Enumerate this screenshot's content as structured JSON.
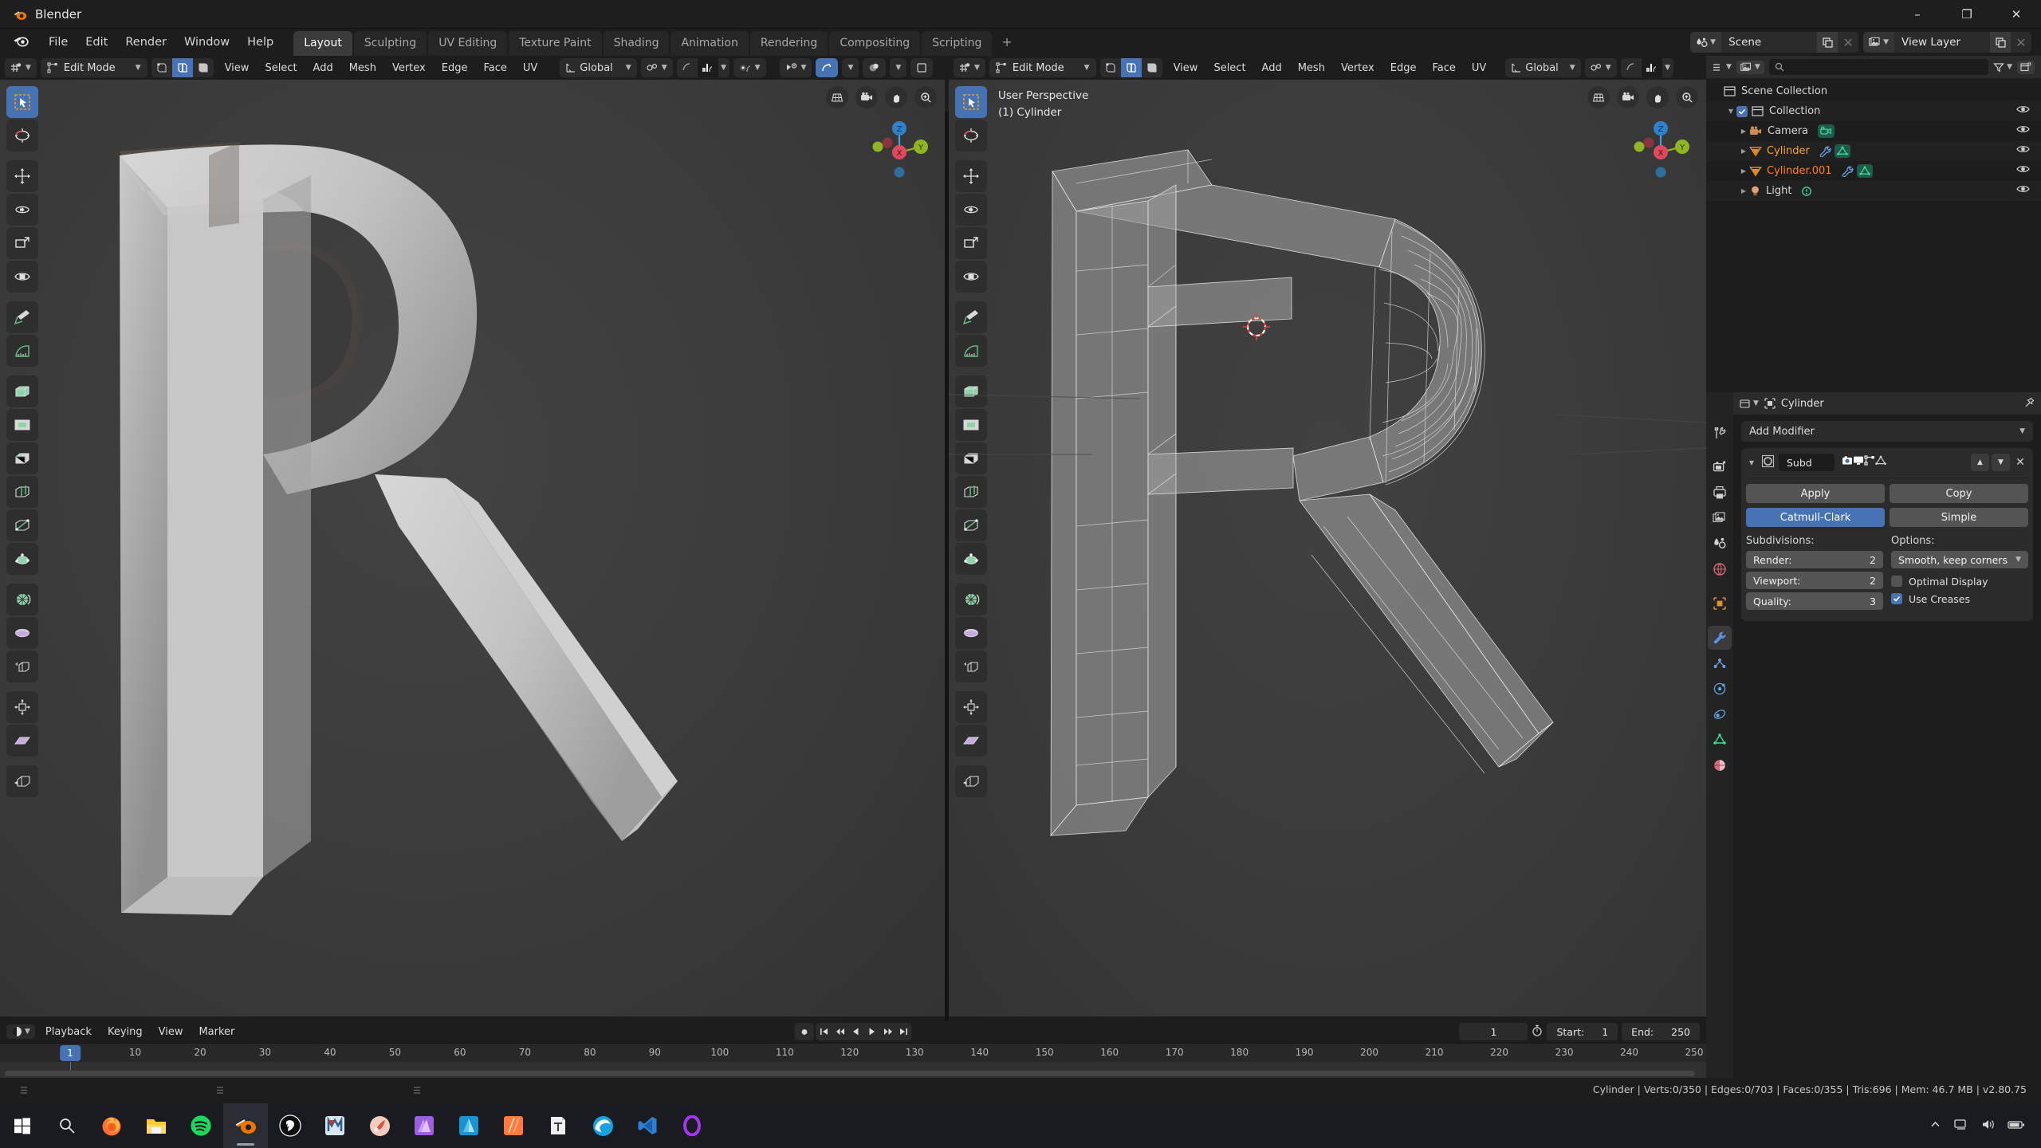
{
  "window": {
    "app_title": "Blender",
    "minimize_label": "–",
    "maximize_label": "❐",
    "close_label": "✕"
  },
  "topbar": {
    "menus": [
      "File",
      "Edit",
      "Render",
      "Window",
      "Help"
    ],
    "workspace_tabs": [
      {
        "label": "Layout",
        "active": true
      },
      {
        "label": "Sculpting",
        "active": false
      },
      {
        "label": "UV Editing",
        "active": false
      },
      {
        "label": "Texture Paint",
        "active": false
      },
      {
        "label": "Shading",
        "active": false
      },
      {
        "label": "Animation",
        "active": false
      },
      {
        "label": "Rendering",
        "active": false
      },
      {
        "label": "Compositing",
        "active": false
      },
      {
        "label": "Scripting",
        "active": false
      }
    ],
    "add_workspace_label": "+",
    "scene_name": "Scene",
    "view_layer_name": "View Layer"
  },
  "viewport_left": {
    "mode": "Edit Mode",
    "menus": [
      "View",
      "Select",
      "Add",
      "Mesh",
      "Vertex",
      "Edge",
      "Face",
      "UV"
    ],
    "transform_orientation": "Global",
    "select_mode": [
      "vertex-select",
      "edge-select",
      "face-select"
    ],
    "active_select_mode": "edge-select"
  },
  "viewport_right": {
    "mode": "Edit Mode",
    "menus": [
      "View",
      "Select",
      "Add",
      "Mesh",
      "Vertex",
      "Edge",
      "Face",
      "UV"
    ],
    "transform_orientation": "Global",
    "overlay_perspective": "User Perspective",
    "overlay_object": "(1) Cylinder"
  },
  "toolbar_tools": [
    "tweak-select-box-tool",
    "cursor-tool",
    "move-tool",
    "rotate-tool",
    "scale-tool",
    "transform-tool",
    "annotate-tool",
    "measure-tool",
    "extrude-region-tool",
    "inset-faces-tool",
    "bevel-tool",
    "loop-cut-tool",
    "knife-tool",
    "poly-build-tool",
    "spin-tool",
    "smooth-tool",
    "edge-slide-tool",
    "shrink-fatten-tool",
    "shear-tool",
    "rip-region-tool"
  ],
  "gizmo": {
    "axis_x": "X",
    "axis_y": "Y",
    "axis_z": "Z",
    "nav_buttons": [
      "toggle-perspective-icon",
      "camera-view-icon",
      "pan-view-icon",
      "zoom-view-icon"
    ]
  },
  "outliner": {
    "search_placeholder": "",
    "rows": [
      {
        "label": "Scene Collection",
        "indent": 0,
        "icon": "collection-icon",
        "color": "normal",
        "expand": "",
        "eye": false,
        "checkbox": false
      },
      {
        "label": "Collection",
        "indent": 1,
        "icon": "collection-icon",
        "color": "normal",
        "expand": "▼",
        "eye": true,
        "checkbox": true
      },
      {
        "label": "Camera",
        "indent": 2,
        "icon": "camera-icon",
        "color": "normal",
        "expand": "▶",
        "eye": true,
        "checkbox": false,
        "data_icons": [
          "camera-data-icon"
        ]
      },
      {
        "label": "Cylinder",
        "indent": 2,
        "icon": "mesh-icon",
        "color": "selected",
        "expand": "▶",
        "eye": true,
        "checkbox": false,
        "data_icons": [
          "modifier-icon",
          "mesh-data-icon"
        ]
      },
      {
        "label": "Cylinder.001",
        "indent": 2,
        "icon": "mesh-icon",
        "color": "active",
        "expand": "▶",
        "eye": true,
        "checkbox": false,
        "data_icons": [
          "modifier-icon",
          "mesh-data-icon"
        ]
      },
      {
        "label": "Light",
        "indent": 2,
        "icon": "light-icon",
        "color": "normal",
        "expand": "▶",
        "eye": true,
        "checkbox": false,
        "data_icons": [
          "light-data-icon"
        ]
      }
    ]
  },
  "properties": {
    "breadcrumb_object": "Cylinder",
    "tabs": [
      {
        "name": "tool-tab",
        "active": false
      },
      {
        "name": "render-tab",
        "active": false
      },
      {
        "name": "output-tab",
        "active": false
      },
      {
        "name": "view-layer-tab",
        "active": false
      },
      {
        "name": "scene-tab",
        "active": false
      },
      {
        "name": "world-tab",
        "active": false
      },
      {
        "name": "object-tab",
        "active": false
      },
      {
        "name": "modifier-tab",
        "active": true
      },
      {
        "name": "particles-tab",
        "active": false
      },
      {
        "name": "physics-tab",
        "active": false
      },
      {
        "name": "constraints-tab",
        "active": false
      },
      {
        "name": "object-data-tab",
        "active": false
      },
      {
        "name": "material-tab",
        "active": false
      }
    ],
    "add_modifier_label": "Add Modifier",
    "modifier": {
      "name": "Subd",
      "display_toggles": [
        "render-toggle",
        "viewport-toggle",
        "edit-mode-toggle",
        "on-cage-toggle"
      ],
      "apply_label": "Apply",
      "copy_label": "Copy",
      "algorithm_options": [
        "Catmull-Clark",
        "Simple"
      ],
      "algorithm_selected": "Catmull-Clark",
      "subdivisions_label": "Subdivisions:",
      "options_label": "Options:",
      "render_label": "Render:",
      "render_value": "2",
      "viewport_label": "Viewport:",
      "viewport_value": "2",
      "quality_label": "Quality:",
      "quality_value": "3",
      "uv_smooth_value": "Smooth, keep corners",
      "optimal_display_label": "Optimal Display",
      "optimal_display_checked": false,
      "use_creases_label": "Use Creases",
      "use_creases_checked": true
    }
  },
  "timeline": {
    "menus": [
      "Playback",
      "Keying",
      "View",
      "Marker"
    ],
    "current_frame": "1",
    "start_label": "Start:",
    "start_value": "1",
    "end_label": "End:",
    "end_value": "250",
    "ticks": [
      "1",
      "10",
      "20",
      "30",
      "40",
      "50",
      "60",
      "70",
      "80",
      "90",
      "100",
      "110",
      "120",
      "130",
      "140",
      "150",
      "160",
      "170",
      "180",
      "190",
      "200",
      "210",
      "220",
      "230",
      "240",
      "250"
    ],
    "playhead_label": "1"
  },
  "statusbar": {
    "text": "Cylinder | Verts:0/350 | Edges:0/703 | Faces:0/355 | Tris:696 | Mem: 46.7 MB | v2.80.75"
  },
  "taskbar": {
    "items": [
      {
        "name": "start-button",
        "color": "#ffffff"
      },
      {
        "name": "search-icon",
        "color": "#e4e4e4"
      },
      {
        "name": "firefox-icon",
        "color": "#ff7139"
      },
      {
        "name": "file-explorer-icon",
        "color": "#ffc83d"
      },
      {
        "name": "spotify-icon",
        "color": "#1ed760"
      },
      {
        "name": "blender-icon",
        "color": "#ea7600"
      },
      {
        "name": "unreal-engine-icon",
        "color": "#ffffff"
      },
      {
        "name": "marmoset-icon",
        "color": "#4a90d9"
      },
      {
        "name": "substance-painter-icon",
        "color": "#f0c0b0"
      },
      {
        "name": "affinity-photo-icon",
        "color": "#9b5fe0"
      },
      {
        "name": "affinity-designer-icon",
        "color": "#2da6e0"
      },
      {
        "name": "affinity-publisher-icon",
        "color": "#ff7a3d"
      },
      {
        "name": "text-editor-icon",
        "color": "#e8e8e8"
      },
      {
        "name": "edge-icon",
        "color": "#1aa2e0"
      },
      {
        "name": "vscode-icon",
        "color": "#2f7fd0"
      },
      {
        "name": "onenote-icon",
        "color": "#a435f0"
      }
    ],
    "tray": [
      "chevron-up-icon",
      "network-icon",
      "volume-icon",
      "battery-icon"
    ]
  },
  "colors": {
    "accent_blue": "#4772b3",
    "selected_orange": "#ffa028",
    "active_orange": "#ff8020",
    "panel_bg": "#1d1d1d",
    "viewport_bg": "#3b3b3b"
  }
}
